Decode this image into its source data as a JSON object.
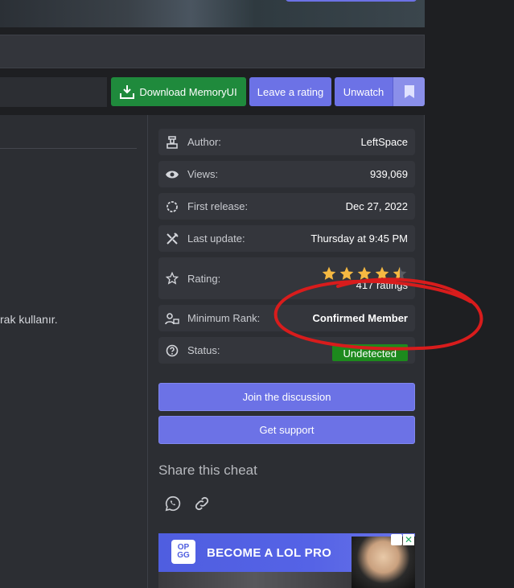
{
  "actions": {
    "download_label": "Download MemoryUI",
    "rate_label": "Leave a rating",
    "unwatch_label": "Unwatch"
  },
  "content": {
    "text_fragment": "rak kullanır."
  },
  "info": {
    "author": {
      "label": "Author:",
      "value": "LeftSpace",
      "icon": "author-icon"
    },
    "views": {
      "label": "Views:",
      "value": "939,069",
      "icon": "eye-icon"
    },
    "first_release": {
      "label": "First release:",
      "value": "Dec 27, 2022",
      "icon": "circle-icon"
    },
    "last_update": {
      "label": "Last update:",
      "value": "Thursday at 9:45 PM",
      "icon": "tools-icon"
    },
    "rating": {
      "label": "Rating:",
      "count": "417 ratings",
      "stars": 4.5,
      "icon": "star-outline-icon"
    },
    "min_rank": {
      "label": "Minimum Rank:",
      "value": "Confirmed Member",
      "icon": "user-lock-icon"
    },
    "status": {
      "label": "Status:",
      "value": "Undetected",
      "icon": "question-icon"
    }
  },
  "sidebar_buttons": {
    "join": "Join the discussion",
    "support": "Get support"
  },
  "share": {
    "title": "Share this cheat",
    "icons": [
      "whatsapp-icon",
      "link-icon"
    ]
  },
  "ad": {
    "logo_text": "OP GG",
    "headline": "BECOME A LOL PRO"
  },
  "colors": {
    "accent": "#6c72e6",
    "download": "#1f8a3c",
    "rank": "#5fa3f0",
    "status": "#1d8a1d",
    "star": "#f5b942",
    "annotation": "#d81c1c"
  }
}
